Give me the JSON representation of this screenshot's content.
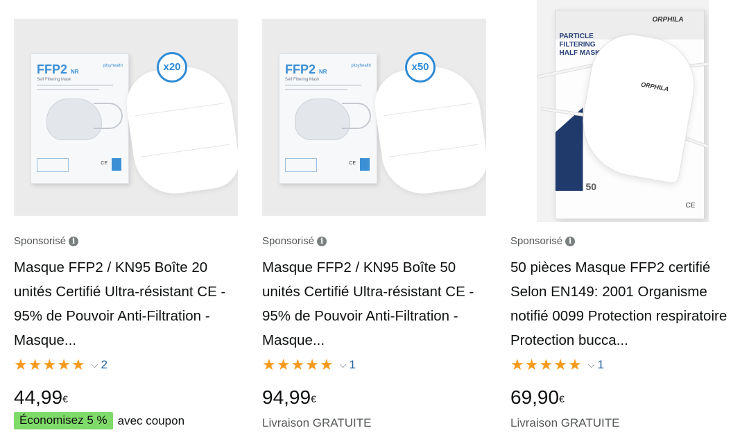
{
  "products": [
    {
      "sponsored_label": "Sponsorisé",
      "title": "Masque FFP2 / KN95 Boîte 20 unités Certifié Ultra-résistant CE - 95% de Pouvoir Anti-Filtration - Masque...",
      "rating_stars": 5,
      "review_count": "2",
      "price": "44,99",
      "currency": "€",
      "coupon_badge": "Économisez 5 %",
      "coupon_text": "avec coupon",
      "image": {
        "box_label": "FFP2",
        "box_suffix": "NR",
        "box_sub": "Self Filtering Mask",
        "quantity_badge": "x20"
      }
    },
    {
      "sponsored_label": "Sponsorisé",
      "title": "Masque FFP2 / KN95 Boîte 50 unités Certifié Ultra-résistant CE - 95% de Pouvoir Anti-Filtration - Masque...",
      "rating_stars": 5,
      "review_count": "1",
      "price": "94,99",
      "currency": "€",
      "delivery": "Livraison GRATUITE",
      "image": {
        "box_label": "FFP2",
        "box_suffix": "NR",
        "box_sub": "Self Filtering Mask",
        "quantity_badge": "x50"
      }
    },
    {
      "sponsored_label": "Sponsorisé",
      "title": "50 pièces Masque FFP2 certifié Selon EN149: 2001 Organisme notifié 0099 Protection respiratoire Protection bucca...",
      "rating_stars": 5,
      "review_count": "1",
      "price": "69,90",
      "currency": "€",
      "delivery": "Livraison GRATUITE",
      "image": {
        "brand": "ORPHILA",
        "box_text": "PARTICLE FILTERING HALF MASK",
        "box_qty": "50",
        "mark": "CE"
      }
    }
  ],
  "icons": {
    "info": "info-icon",
    "star": "star-icon",
    "chevron": "chevron-down-icon"
  },
  "colors": {
    "star": "#f59a1c",
    "link": "#2162a1",
    "coupon_bg": "#7fda69",
    "muted": "#565959",
    "box_blue": "#2e8bd8"
  }
}
